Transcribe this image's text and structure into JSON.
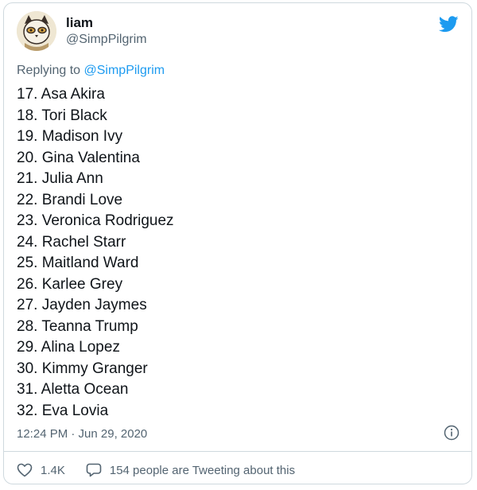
{
  "tweet": {
    "author": {
      "display_name": "liam",
      "handle": "@SimpPilgrim",
      "avatar_icon": "cat-avatar-icon"
    },
    "reply_context": {
      "prefix": "Replying to ",
      "mention": "@SimpPilgrim"
    },
    "lines": [
      "17. Asa Akira",
      "18. Tori Black",
      "19. Madison Ivy",
      "20. Gina Valentina",
      "21. Julia Ann",
      "22. Brandi Love",
      "23. Veronica Rodriguez",
      "24. Rachel Starr",
      "25. Maitland Ward",
      "26. Karlee Grey",
      "27. Jayden Jaymes",
      "28. Teanna Trump",
      "29. Alina Lopez",
      "30. Kimmy Granger",
      "31. Aletta Ocean",
      "32. Eva Lovia"
    ],
    "timestamp": "12:24 PM · Jun 29, 2020",
    "likes": "1.4K",
    "conversation_text": "154 people are Tweeting about this"
  },
  "icons": {
    "brand": "twitter-bird-icon",
    "info": "info-icon",
    "like": "heart-icon",
    "reply": "speech-bubble-icon"
  },
  "colors": {
    "brand": "#1d9bf0",
    "text_primary": "#0f1419",
    "text_secondary": "#536471",
    "border": "#cfd9de"
  }
}
